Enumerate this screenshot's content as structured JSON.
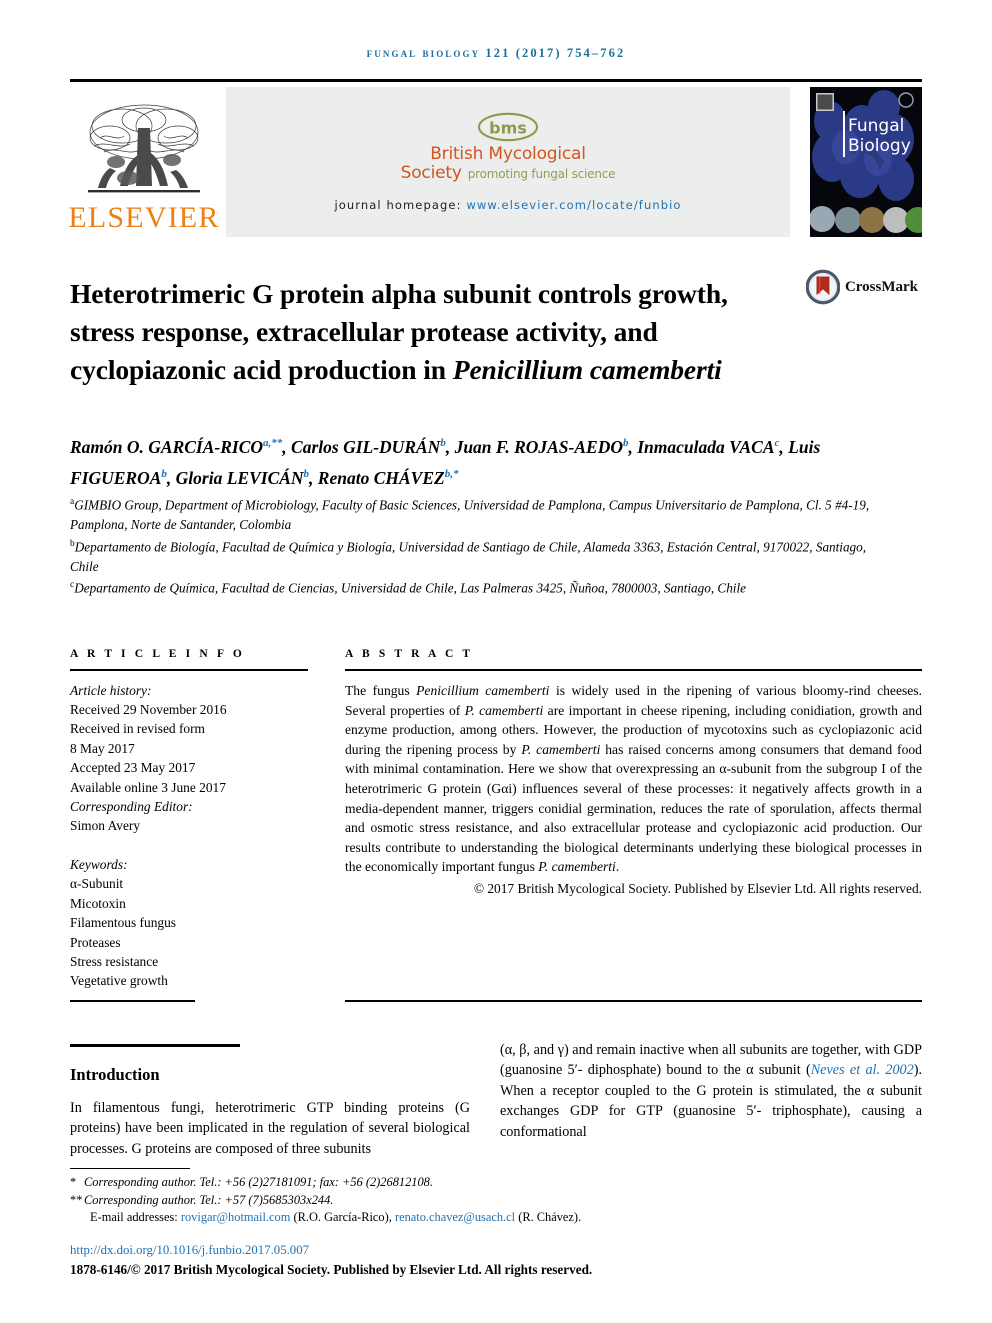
{
  "header": {
    "running_head": "Fungal Biology 121 (2017) 754–762"
  },
  "masthead": {
    "publisher_logo_text": "ELSEVIER",
    "society_logo_mark": "bms",
    "society_line1": "British Mycological",
    "society_line2": "Society",
    "society_tagline": "promoting fungal science",
    "homepage_label": "journal homepage:",
    "homepage_url": "www.elsevier.com/locate/funbio",
    "cover_title_line1": "Fungal",
    "cover_title_line2": "Biology"
  },
  "article": {
    "title_part1": "Heterotrimeric G protein alpha subunit controls growth, stress response, extracellular protease activity, and cyclopiazonic acid production in ",
    "title_italic": "Penicillium camemberti",
    "crossmark_label": "CrossMark"
  },
  "authors": {
    "line1": "Ramón O. GARCÍA-RICO",
    "line1_sup": "a,**",
    "a2": "Carlos GIL-DURÁN",
    "a2_sup": "b",
    "a3": "Juan F. ROJAS-AEDO",
    "a3_sup": "b",
    "a4": "Inmaculada VACA",
    "a4_sup": "c",
    "a5": "Luis FIGUEROA",
    "a5_sup": "b",
    "a6": "Gloria LEVICÁN",
    "a6_sup": "b",
    "a7": "Renato CHÁVEZ",
    "a7_sup": "b,*"
  },
  "affiliations": [
    {
      "marker": "a",
      "text": "GIMBIO Group, Department of Microbiology, Faculty of Basic Sciences, Universidad de Pamplona, Campus Universitario de Pamplona, Cl. 5 #4-19, Pamplona, Norte de Santander, Colombia"
    },
    {
      "marker": "b",
      "text": "Departamento de Biología, Facultad de Química y Biología, Universidad de Santiago de Chile, Alameda 3363, Estación Central, 9170022, Santiago, Chile"
    },
    {
      "marker": "c",
      "text": "Departamento de Química, Facultad de Ciencias, Universidad de Chile, Las Palmeras 3425, Ñuñoa, 7800003, Santiago, Chile"
    }
  ],
  "article_info": {
    "section_label": "A R T I C L E   I N F O",
    "history_label": "Article history:",
    "received": "Received 29 November 2016",
    "revised_label": "Received in revised form",
    "revised_date": "8 May 2017",
    "accepted": "Accepted 23 May 2017",
    "available_online": "Available online 3 June 2017",
    "editor_label": "Corresponding Editor:",
    "editor_name": "Simon Avery",
    "keywords_label": "Keywords:",
    "keywords": [
      "α-Subunit",
      "Micotoxin",
      "Filamentous fungus",
      "Proteases",
      "Stress resistance",
      "Vegetative growth"
    ]
  },
  "abstract": {
    "section_label": "A B S T R A C T",
    "p1_a": "The fungus ",
    "p1_italic1": "Penicillium camemberti",
    "p1_b": " is widely used in the ripening of various bloomy-rind cheeses. Several properties of ",
    "p1_italic2": "P. camemberti",
    "p1_c": " are important in cheese ripening, including conidiation, growth and enzyme production, among others. However, the production of mycotoxins such as cyclopiazonic acid during the ripening process by ",
    "p1_italic3": "P. camemberti",
    "p1_d": " has raised concerns among consumers that demand food with minimal contamination. Here we show that overexpressing an α-subunit from the subgroup I of the heterotrimeric G protein (Gαi) influences several of these processes: it negatively affects growth in a media-dependent manner, triggers conidial germination, reduces the rate of sporulation, affects thermal and osmotic stress resistance, and also extracellular protease and cyclopiazonic acid production. Our results contribute to understanding the biological determinants underlying these biological processes in the economically important fungus ",
    "p1_italic4": "P. camemberti",
    "p1_e": ".",
    "copyright": "© 2017 British Mycological Society. Published by Elsevier Ltd. All rights reserved."
  },
  "body": {
    "intro_heading": "Introduction",
    "left_p1": "In filamentous fungi, heterotrimeric GTP binding proteins (G proteins) have been implicated in the regulation of several biological processes. G proteins are composed of three subunits",
    "right_p1_a": "(α, β, and γ) and remain inactive when all subunits are together, with GDP (guanosine 5′- diphosphate) bound to the α subunit (",
    "right_citation": "Neves et al. 2002",
    "right_p1_b": "). When a receptor coupled to the G protein is stimulated, the α subunit exchanges GDP for GTP (guanosine 5′- triphosphate), causing a conformational"
  },
  "footnotes": {
    "fn1_marker": "*",
    "fn1_text": "Corresponding author. Tel.: +56 (2)27181091; fax: +56 (2)26812108.",
    "fn2_marker": "**",
    "fn2_text": "Corresponding author. Tel.: +57 (7)5685303x244.",
    "email_label": "E-mail addresses:",
    "email1": "rovigar@hotmail.com",
    "email1_owner": "(R.O. García-Rico)",
    "email2": "renato.chavez@usach.cl",
    "email2_owner": "(R. Chávez).",
    "doi": "http://dx.doi.org/10.1016/j.funbio.2017.05.007",
    "issn_line": "1878-6146/© 2017 British Mycological Society. Published by Elsevier Ltd. All rights reserved."
  },
  "colors": {
    "link_blue": "#1f72b5",
    "running_head_blue": "#1a6f9e",
    "elsevier_orange": "#f07f13",
    "bms_orange": "#d4541f",
    "bms_green": "#8fa054",
    "panel_grey": "#eceded"
  }
}
